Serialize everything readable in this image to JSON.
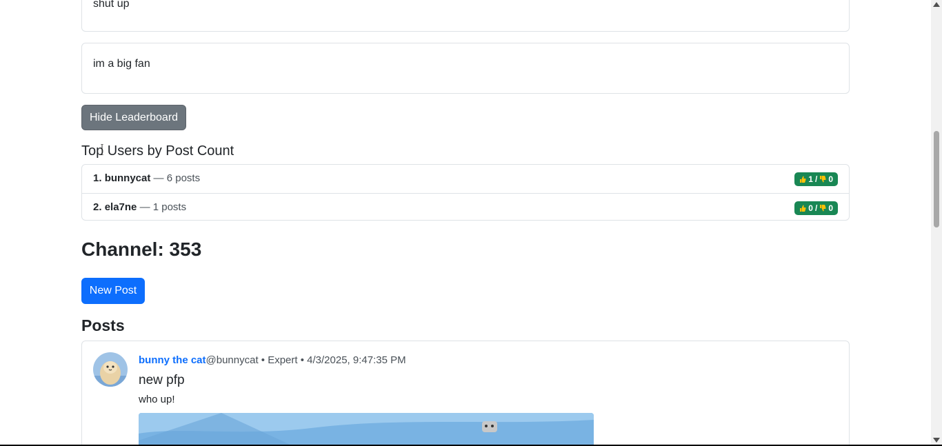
{
  "cards": [
    {
      "text": "shut up"
    },
    {
      "text": "im a big fan"
    }
  ],
  "leaderboard": {
    "toggle_label": "Hide Leaderboard",
    "title": "Top Users by Post Count",
    "entries": [
      {
        "rank": "1.",
        "username": "bunnycat",
        "posts": "— 6 posts",
        "likes": "1",
        "dislikes": "0"
      },
      {
        "rank": "2.",
        "username": "ela7ne",
        "posts": "— 1 posts",
        "likes": "0",
        "dislikes": "0"
      }
    ],
    "badge_separator": "/"
  },
  "channel": {
    "title": "Channel: 353",
    "new_post_label": "New Post"
  },
  "posts": {
    "heading": "Posts",
    "items": [
      {
        "author": "bunny the cat",
        "handle": "@bunnycat",
        "meta": " • Expert • 4/3/2025, 9:47:35 PM",
        "title": "new pfp",
        "body": "who up!"
      }
    ]
  },
  "colors": {
    "primary": "#0d6efd",
    "secondary": "#6c757d",
    "success": "#198754"
  },
  "icons": {
    "like": "thumbs-up-icon",
    "dislike": "thumbs-down-icon"
  }
}
